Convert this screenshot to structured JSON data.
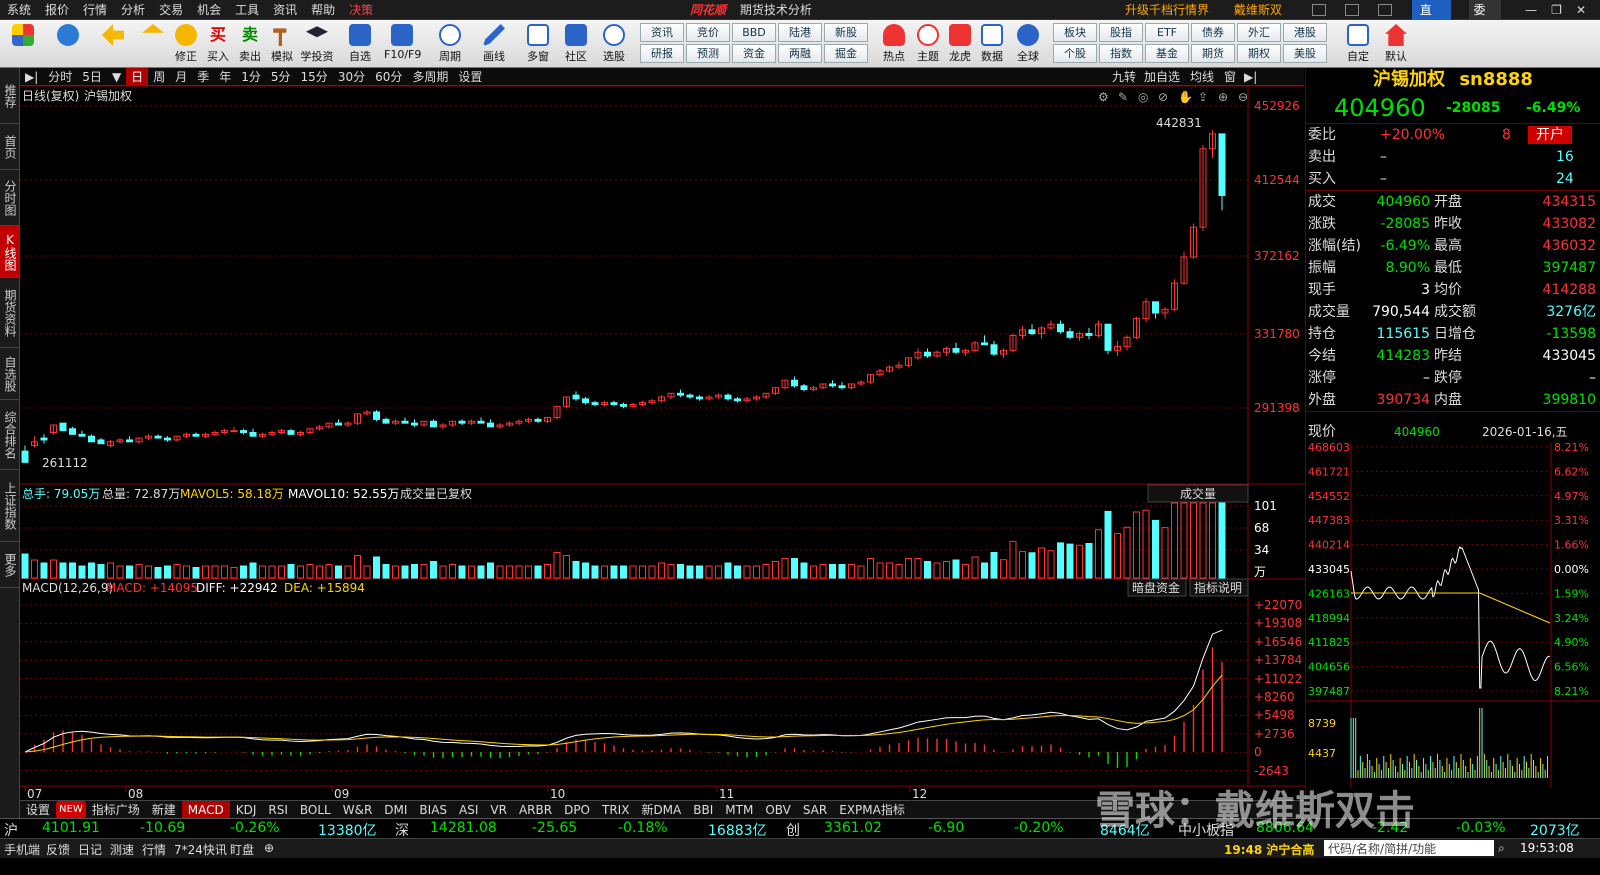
{
  "menubar": {
    "items": [
      "系统",
      "报价",
      "行情",
      "分析",
      "交易",
      "机会",
      "工具",
      "资讯",
      "帮助",
      "决策"
    ],
    "brand": "同花顺",
    "title": "期货技术分析",
    "upgrade": "升级千档行情界面",
    "user": "戴维斯双击",
    "broadcast": "直播",
    "entrust": "委托"
  },
  "toolbar": {
    "buttons": [
      "修正",
      "买入",
      "卖出",
      "模拟",
      "学投资",
      "自选",
      "F10/F9",
      "周期",
      "画线",
      "多窗",
      "社区",
      "选股"
    ],
    "grid": [
      "资讯",
      "竞价",
      "BBD",
      "陆港",
      "新股",
      "研报",
      "预测",
      "资金",
      "两融",
      "掘金"
    ],
    "buttons2": [
      "热点",
      "主题",
      "龙虎",
      "数据",
      "全球"
    ],
    "grid2": [
      "板块",
      "股指",
      "ETF",
      "债券",
      "外汇",
      "港股",
      "个股",
      "指数",
      "基金",
      "期货",
      "期权",
      "美股"
    ],
    "buttons3": [
      "自定",
      "默认"
    ]
  },
  "lefttabs": [
    "推荐",
    "首页",
    "分时图",
    "K线图",
    "期货资料",
    "自选股",
    "综合排名",
    "上证指数",
    "更多"
  ],
  "periodbar": {
    "items": [
      "分时",
      "5日",
      "日",
      "周",
      "月",
      "季",
      "年",
      "1分",
      "5分",
      "15分",
      "30分",
      "60分",
      "多周期",
      "设置"
    ],
    "right": [
      "九转",
      "加自选",
      "均线",
      "窗"
    ]
  },
  "kline": {
    "label": "日线(复权)",
    "name": "沪锡加权",
    "high_label": "442831",
    "low_label": "261112",
    "yticks": [
      "452926",
      "412544",
      "372162",
      "331780",
      "291398"
    ]
  },
  "volume": {
    "label": "总手: 79.05万",
    "label2": "总量: 72.87万",
    "ma5": "MAVOL5: 58.18万",
    "ma10": "MAVOL10: 52.55万",
    "note": "成交量已复权",
    "selector": "成交量",
    "yticks": [
      "101",
      "68",
      "34",
      "万"
    ]
  },
  "macd": {
    "label": "MACD(12,26,9)",
    "macd": "MACD: +14095",
    "diff": "DIFF: +22942",
    "dea": "DEA: +15894",
    "btn1": "暗盘资金",
    "btn2": "指标说明",
    "yticks": [
      "+22070",
      "+19308",
      "+16546",
      "+13784",
      "+11022",
      "+8260",
      "+5498",
      "+2736",
      "0",
      "-2643"
    ]
  },
  "xaxis": [
    "07",
    "08",
    "09",
    "10",
    "11",
    "12"
  ],
  "bottomtabs": [
    "设置",
    "NEW",
    "指标广场",
    "新建",
    "MACD",
    "KDJ",
    "RSI",
    "BOLL",
    "W&R",
    "DMI",
    "BIAS",
    "ASI",
    "VR",
    "ARBR",
    "DPO",
    "TRIX",
    "新DMA",
    "BBI",
    "MTM",
    "OBV",
    "SAR",
    "EXPMA指标"
  ],
  "quote": {
    "name": "沪锡加权",
    "code": "sn8888",
    "price": "404960",
    "change": "-28085",
    "pct": "-6.49%",
    "open_btn": "开户",
    "rows": [
      [
        "委比",
        "+20.00%",
        "8",
        ""
      ],
      [
        "卖出",
        "–",
        "16",
        ""
      ],
      [
        "买入",
        "–",
        "24",
        ""
      ]
    ],
    "grid": [
      [
        "成交",
        "404960",
        "开盘",
        "434315"
      ],
      [
        "涨跌",
        "-28085",
        "昨收",
        "433082"
      ],
      [
        "涨幅(结)",
        "-6.49%",
        "最高",
        "436032"
      ],
      [
        "振幅",
        "8.90%",
        "最低",
        "397487"
      ],
      [
        "现手",
        "3",
        "均价",
        "414288"
      ],
      [
        "成交量",
        "790,544",
        "成交额",
        "3276亿"
      ],
      [
        "持仓",
        "115615",
        "日增仓",
        "-13598"
      ],
      [
        "今结",
        "414283",
        "昨结",
        "433045"
      ],
      [
        "涨停",
        "–",
        "跌停",
        "–"
      ],
      [
        "外盘",
        "390734",
        "内盘",
        "399810"
      ]
    ],
    "now_label": "现价",
    "now_value": "404960",
    "date": "2026-01-16,五"
  },
  "mini": {
    "left": [
      "468603",
      "461721",
      "454552",
      "447383",
      "440214",
      "433045",
      "426163",
      "418994",
      "411825",
      "404656",
      "397487",
      "8739",
      "4437"
    ],
    "right": [
      "8.21%",
      "6.62%",
      "4.97%",
      "3.31%",
      "1.66%",
      "0.00%",
      "1.59%",
      "3.24%",
      "4.90%",
      "6.56%",
      "8.21%"
    ]
  },
  "indexbar": {
    "sh": "沪",
    "sh_val": "4101.91",
    "sh_chg": "-10.69",
    "sh_pct": "-0.26%",
    "sh_amt": "13380亿",
    "sz": "深",
    "sz_val": "14281.08",
    "sz_chg": "-25.65",
    "sz_pct": "-0.18%",
    "sz_amt": "16883亿",
    "cy": "创",
    "cy_val": "3361.02",
    "cy_chg": "-6.90",
    "cy_pct": "-0.20%",
    "cy_amt": "8464亿",
    "zx": "中小板指",
    "zx_val": "8806.64",
    "zx_chg": "-2.42",
    "zx_pct": "-0.03%",
    "zx_amt": "2073亿"
  },
  "statusbar": {
    "items": [
      "手机端",
      "反馈",
      "日记",
      "测速",
      "行情",
      "7*24快讯",
      "盯盘"
    ],
    "news": "19:48 沪宁合高",
    "search": "代码/名称/简拼/功能",
    "time": "19:53:08"
  },
  "watermark": "雪球：戴维斯双击",
  "colors": {
    "up": "#ff3232",
    "down": "#54ffff",
    "white": "#ffffff",
    "yellow": "#ffd400",
    "green": "#00e000",
    "grid": "#7a0000"
  },
  "candles": [
    [
      268,
      271,
      265,
      262
    ],
    [
      271,
      276,
      270,
      273
    ],
    [
      275,
      277,
      272,
      274
    ],
    [
      278,
      281,
      277,
      282
    ],
    [
      283,
      282,
      280,
      279
    ],
    [
      280,
      281,
      278,
      277
    ],
    [
      277,
      279,
      276,
      276
    ],
    [
      276,
      277,
      274,
      273
    ],
    [
      274,
      275,
      272,
      272
    ],
    [
      271,
      274,
      270,
      273
    ],
    [
      273,
      275,
      272,
      274
    ],
    [
      274,
      276,
      273,
      273
    ],
    [
      273,
      275,
      272,
      275
    ],
    [
      275,
      277,
      274,
      276
    ],
    [
      276,
      277,
      275,
      275
    ],
    [
      275,
      276,
      273,
      274
    ],
    [
      274,
      276,
      273,
      276
    ],
    [
      276,
      278,
      275,
      277
    ],
    [
      277,
      278,
      276,
      276
    ],
    [
      276,
      278,
      275,
      277
    ],
    [
      277,
      279,
      276,
      278
    ],
    [
      278,
      280,
      277,
      279
    ],
    [
      279,
      281,
      278,
      279
    ],
    [
      279,
      280,
      277,
      278
    ],
    [
      278,
      280,
      276,
      276
    ],
    [
      276,
      278,
      275,
      277
    ],
    [
      277,
      279,
      276,
      278
    ],
    [
      278,
      280,
      277,
      279
    ],
    [
      279,
      280,
      277,
      277
    ],
    [
      277,
      279,
      276,
      278
    ],
    [
      278,
      280,
      277,
      280
    ],
    [
      280,
      282,
      279,
      281
    ],
    [
      281,
      283,
      280,
      283
    ],
    [
      283,
      285,
      282,
      282
    ],
    [
      282,
      284,
      281,
      283
    ],
    [
      283,
      288,
      282,
      288
    ],
    [
      288,
      290,
      287,
      289
    ],
    [
      289,
      290,
      284,
      285
    ],
    [
      285,
      286,
      283,
      283
    ],
    [
      283,
      285,
      282,
      284
    ],
    [
      284,
      286,
      283,
      283
    ],
    [
      283,
      285,
      281,
      282
    ],
    [
      282,
      284,
      281,
      284
    ],
    [
      284,
      285,
      281,
      281
    ],
    [
      281,
      283,
      280,
      282
    ],
    [
      282,
      284,
      281,
      284
    ],
    [
      284,
      285,
      282,
      283
    ],
    [
      283,
      285,
      282,
      284
    ],
    [
      284,
      286,
      283,
      283
    ],
    [
      283,
      285,
      281,
      281
    ],
    [
      281,
      283,
      280,
      282
    ],
    [
      282,
      284,
      281,
      283
    ],
    [
      283,
      285,
      282,
      284
    ],
    [
      284,
      286,
      283,
      285
    ],
    [
      285,
      286,
      283,
      284
    ],
    [
      284,
      286,
      283,
      286
    ],
    [
      286,
      292,
      285,
      292
    ],
    [
      292,
      297,
      291,
      297
    ],
    [
      298,
      300,
      295,
      296
    ],
    [
      296,
      297,
      293,
      294
    ],
    [
      294,
      295,
      292,
      293
    ],
    [
      293,
      295,
      292,
      294
    ],
    [
      294,
      295,
      292,
      293
    ],
    [
      293,
      294,
      291,
      292
    ],
    [
      292,
      294,
      291,
      293
    ],
    [
      293,
      295,
      292,
      294
    ],
    [
      294,
      296,
      293,
      295
    ],
    [
      295,
      298,
      294,
      297
    ],
    [
      297,
      299,
      296,
      299
    ],
    [
      299,
      301,
      297,
      298
    ],
    [
      298,
      299,
      296,
      297
    ],
    [
      297,
      298,
      295,
      296
    ],
    [
      296,
      298,
      295,
      297
    ],
    [
      297,
      299,
      296,
      298
    ],
    [
      298,
      299,
      295,
      296
    ],
    [
      296,
      297,
      294,
      295
    ],
    [
      295,
      297,
      294,
      296
    ],
    [
      296,
      298,
      295,
      297
    ],
    [
      297,
      299,
      296,
      299
    ],
    [
      299,
      302,
      298,
      302
    ],
    [
      302,
      306,
      301,
      306
    ],
    [
      306,
      308,
      302,
      303
    ],
    [
      303,
      304,
      300,
      301
    ],
    [
      301,
      303,
      300,
      302
    ],
    [
      302,
      304,
      301,
      304
    ],
    [
      304,
      306,
      302,
      303
    ],
    [
      303,
      305,
      301,
      302
    ],
    [
      302,
      304,
      301,
      304
    ],
    [
      304,
      306,
      303,
      305
    ],
    [
      305,
      309,
      304,
      309
    ],
    [
      309,
      312,
      308,
      311
    ],
    [
      311,
      314,
      310,
      313
    ],
    [
      313,
      316,
      312,
      314
    ],
    [
      314,
      318,
      313,
      318
    ],
    [
      318,
      323,
      317,
      321
    ],
    [
      321,
      323,
      318,
      319
    ],
    [
      319,
      322,
      318,
      321
    ],
    [
      321,
      324,
      319,
      323
    ],
    [
      323,
      326,
      320,
      321
    ],
    [
      321,
      323,
      319,
      322
    ],
    [
      322,
      327,
      321,
      326
    ],
    [
      326,
      330,
      325,
      325
    ],
    [
      325,
      327,
      319,
      320
    ],
    [
      320,
      323,
      318,
      322
    ],
    [
      322,
      331,
      321,
      330
    ],
    [
      330,
      335,
      328,
      333
    ],
    [
      333,
      336,
      330,
      331
    ],
    [
      331,
      335,
      328,
      334
    ],
    [
      334,
      338,
      333,
      336
    ],
    [
      336,
      338,
      331,
      332
    ],
    [
      332,
      334,
      328,
      329
    ],
    [
      329,
      332,
      327,
      331
    ],
    [
      331,
      334,
      328,
      330
    ],
    [
      330,
      338,
      329,
      336
    ],
    [
      336,
      332,
      320,
      322
    ],
    [
      322,
      327,
      319,
      324
    ],
    [
      324,
      330,
      322,
      329
    ],
    [
      329,
      340,
      328,
      339
    ],
    [
      339,
      350,
      337,
      348
    ],
    [
      348,
      347,
      339,
      342
    ],
    [
      342,
      345,
      339,
      344
    ],
    [
      344,
      360,
      343,
      358
    ],
    [
      358,
      375,
      357,
      372
    ],
    [
      372,
      390,
      371,
      388
    ],
    [
      388,
      432,
      386,
      430
    ],
    [
      430,
      440,
      425,
      438
    ],
    [
      438,
      436,
      397,
      405
    ]
  ]
}
